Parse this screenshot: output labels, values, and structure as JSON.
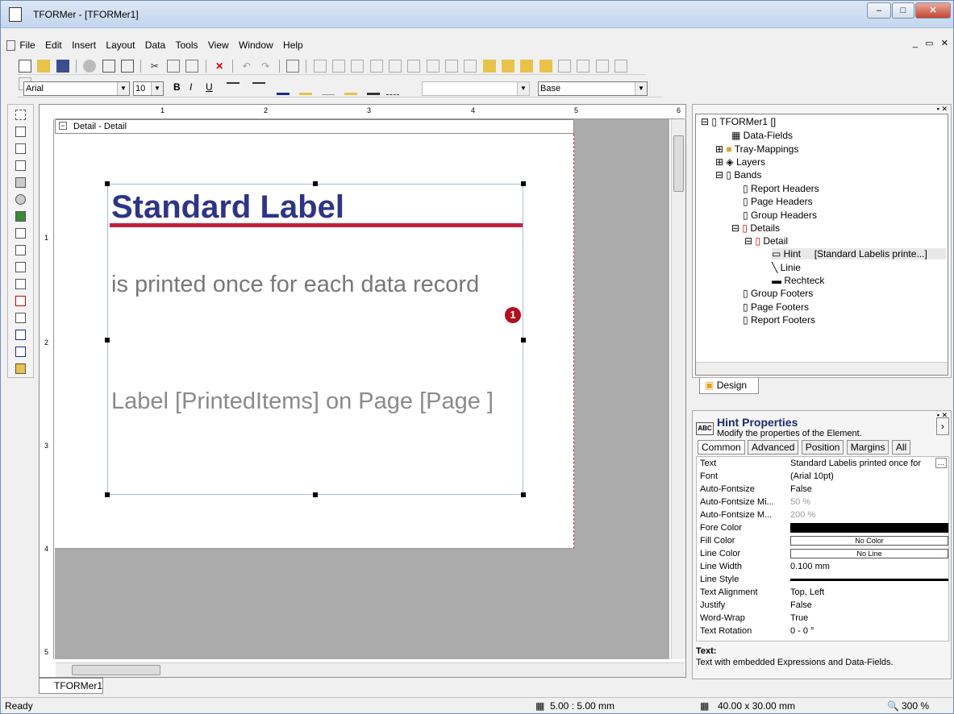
{
  "window": {
    "title": "TFORMer - [TFORMer1]"
  },
  "menu": [
    "File",
    "Edit",
    "Insert",
    "Layout",
    "Data",
    "Tools",
    "View",
    "Window",
    "Help"
  ],
  "toolbar": {
    "font": "Arial",
    "size": "10",
    "style": "Base",
    "bold": "B",
    "italic": "I",
    "underline": "U"
  },
  "designer": {
    "band_label": "Detail - Detail",
    "ruler_h": [
      "1",
      "2",
      "3",
      "4",
      "5",
      "6"
    ],
    "ruler_v": [
      "1",
      "2",
      "3",
      "4",
      "5"
    ],
    "title_text": "Standard Label",
    "sub_text": "is printed once for each data record",
    "footer_text": "Label [PrintedItems] on Page [Page ]",
    "marker": "1",
    "tab": "TFORMer1"
  },
  "tree": {
    "items": [
      {
        "label": "TFORMer1 []"
      },
      {
        "label": "Data-Fields"
      },
      {
        "label": "Tray-Mappings"
      },
      {
        "label": "Layers"
      },
      {
        "label": "Bands"
      },
      {
        "label": "Report Headers"
      },
      {
        "label": "Page Headers"
      },
      {
        "label": "Group Headers"
      },
      {
        "label": "Details"
      },
      {
        "label": "Detail"
      },
      {
        "label": "Hint"
      },
      {
        "label": "Linie"
      },
      {
        "label": "Rechteck"
      },
      {
        "label": "Group Footers"
      },
      {
        "label": "Page Footers"
      },
      {
        "label": "Report Footers"
      }
    ],
    "hint_value": "[Standard Labelis printe...]",
    "design_tab": "Design"
  },
  "props": {
    "title": "Hint Properties",
    "subtitle": "Modify the properties of the Element.",
    "abc": "ABC",
    "tabs": [
      "Common",
      "Advanced",
      "Position",
      "Margins",
      "All"
    ],
    "rows": [
      {
        "k": "Text",
        "v": "Standard Labelis printed once for"
      },
      {
        "k": "Font",
        "v": "(Arial 10pt)"
      },
      {
        "k": "Auto-Fontsize",
        "v": "False"
      },
      {
        "k": "Auto-Fontsize Mi...",
        "v": "50 %"
      },
      {
        "k": "Auto-Fontsize M...",
        "v": "200 %"
      },
      {
        "k": "Fore Color",
        "v": ""
      },
      {
        "k": "Fill Color",
        "v": "No Color"
      },
      {
        "k": "Line Color",
        "v": "No Line"
      },
      {
        "k": "Line Width",
        "v": "0.100 mm"
      },
      {
        "k": "Line Style",
        "v": ""
      },
      {
        "k": "Text Alignment",
        "v": "Top, Left"
      },
      {
        "k": "Justify",
        "v": "False"
      },
      {
        "k": "Word-Wrap",
        "v": "True"
      },
      {
        "k": "Text Rotation",
        "v": "0 - 0 °"
      }
    ],
    "help_title": "Text:",
    "help_text": "Text with embedded Expressions and Data-Fields."
  },
  "status": {
    "left": "Ready",
    "grid": "5.00 : 5.00 mm",
    "size": "40.00 x 30.00 mm",
    "zoom": "300 %"
  }
}
